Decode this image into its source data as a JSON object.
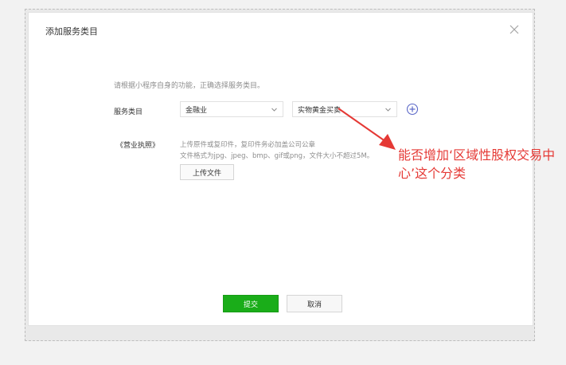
{
  "dialog": {
    "title": "添加服务类目",
    "hint": "请根据小程序自身的功能，正确选择服务类目。",
    "category_label": "服务类目",
    "category_primary": "金融业",
    "category_secondary": "实物黄金买卖",
    "license_label": "《营业执照》",
    "upload_desc_line1": "上传原件或复印件，复印件务必加盖公司公章",
    "upload_desc_line2": "文件格式为jpg、jpeg、bmp、gif或png，文件大小不超过5M。",
    "upload_button": "上传文件",
    "submit_button": "提交",
    "cancel_button": "取消"
  },
  "annotation": {
    "text": "能否增加‘区域性股权交易中心’这个分类",
    "color": "#e53935"
  },
  "colors": {
    "primary_green": "#1aad19"
  },
  "icons": {
    "close": "close-icon",
    "chevron": "chevron-down-icon",
    "add": "plus-circle-icon"
  }
}
